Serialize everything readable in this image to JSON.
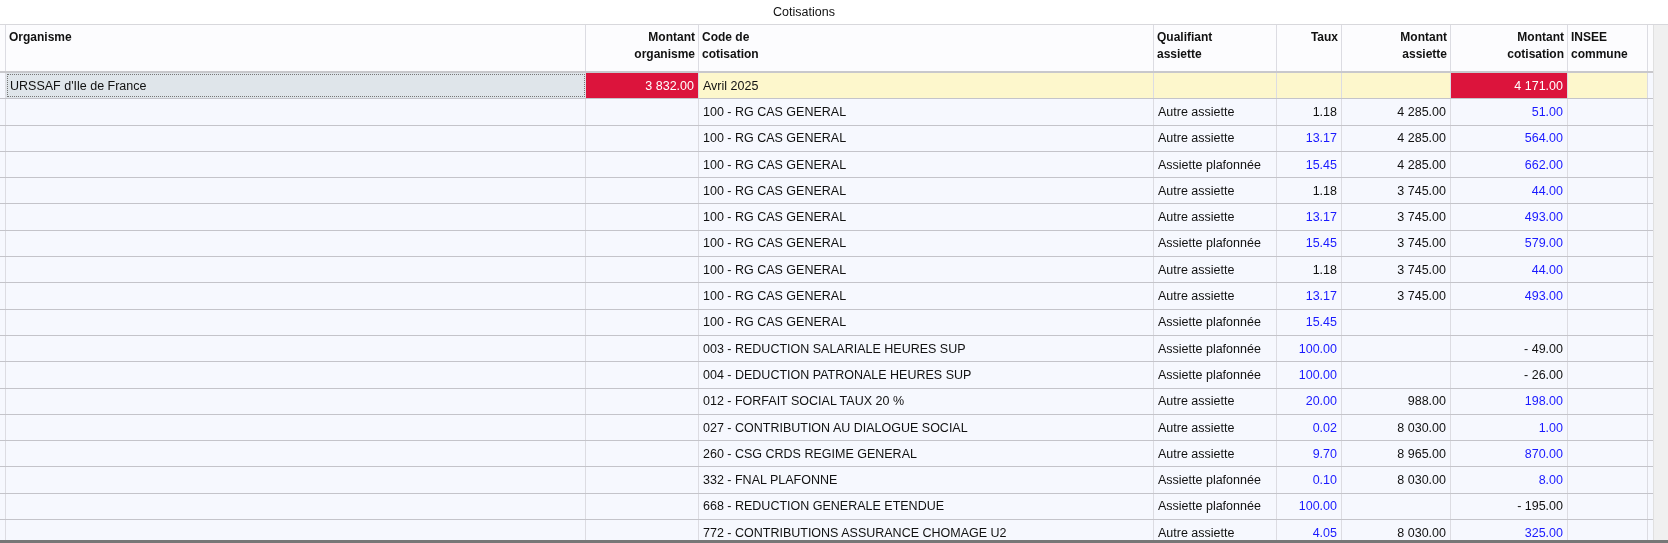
{
  "title": "Cotisations",
  "columns": [
    {
      "lines": [
        "Organisme"
      ]
    },
    {
      "lines": [
        "Montant",
        "organisme"
      ]
    },
    {
      "lines": [
        "Code de",
        "cotisation"
      ]
    },
    {
      "lines": [
        "Qualifiant",
        "assiette"
      ]
    },
    {
      "lines": [
        "Taux"
      ]
    },
    {
      "lines": [
        "Montant",
        "assiette"
      ]
    },
    {
      "lines": [
        "Montant",
        "cotisation"
      ]
    },
    {
      "lines": [
        "INSEE",
        "commune"
      ]
    }
  ],
  "rows": [
    {
      "kind": "group",
      "organisme": "URSSAF d'Ile de France",
      "selected": true,
      "montant_organisme": "3 832.00",
      "code": "Avril 2025",
      "montant_cotisation": "4 171.00"
    },
    {
      "kind": "detail",
      "code": "100 - RG CAS GENERAL",
      "qualifiant": "Autre assiette",
      "taux": "1.18",
      "taux_highlighted": false,
      "montant_assiette": "4 285.00",
      "montant_cotisation": "51.00",
      "cotisation_highlighted": true
    },
    {
      "kind": "detail",
      "code": "100 - RG CAS GENERAL",
      "qualifiant": "Autre assiette",
      "taux": "13.17",
      "taux_highlighted": true,
      "montant_assiette": "4 285.00",
      "montant_cotisation": "564.00",
      "cotisation_highlighted": true
    },
    {
      "kind": "detail",
      "code": "100 - RG CAS GENERAL",
      "qualifiant": "Assiette plafonnée",
      "taux": "15.45",
      "taux_highlighted": true,
      "montant_assiette": "4 285.00",
      "montant_cotisation": "662.00",
      "cotisation_highlighted": true
    },
    {
      "kind": "detail",
      "code": "100 - RG CAS GENERAL",
      "qualifiant": "Autre assiette",
      "taux": "1.18",
      "taux_highlighted": false,
      "montant_assiette": "3 745.00",
      "montant_cotisation": "44.00",
      "cotisation_highlighted": true
    },
    {
      "kind": "detail",
      "code": "100 - RG CAS GENERAL",
      "qualifiant": "Autre assiette",
      "taux": "13.17",
      "taux_highlighted": true,
      "montant_assiette": "3 745.00",
      "montant_cotisation": "493.00",
      "cotisation_highlighted": true
    },
    {
      "kind": "detail",
      "code": "100 - RG CAS GENERAL",
      "qualifiant": "Assiette plafonnée",
      "taux": "15.45",
      "taux_highlighted": true,
      "montant_assiette": "3 745.00",
      "montant_cotisation": "579.00",
      "cotisation_highlighted": true
    },
    {
      "kind": "detail",
      "code": "100 - RG CAS GENERAL",
      "qualifiant": "Autre assiette",
      "taux": "1.18",
      "taux_highlighted": false,
      "montant_assiette": "3 745.00",
      "montant_cotisation": "44.00",
      "cotisation_highlighted": true
    },
    {
      "kind": "detail",
      "code": "100 - RG CAS GENERAL",
      "qualifiant": "Autre assiette",
      "taux": "13.17",
      "taux_highlighted": true,
      "montant_assiette": "3 745.00",
      "montant_cotisation": "493.00",
      "cotisation_highlighted": true
    },
    {
      "kind": "detail",
      "code": "100 - RG CAS GENERAL",
      "qualifiant": "Assiette plafonnée",
      "taux": "15.45",
      "taux_highlighted": true
    },
    {
      "kind": "detail",
      "code": "003 - REDUCTION SALARIALE HEURES SUP",
      "qualifiant": "Assiette plafonnée",
      "taux": "100.00",
      "taux_highlighted": true,
      "montant_cotisation": "- 49.00",
      "cotisation_highlighted": false
    },
    {
      "kind": "detail",
      "code": "004 - DEDUCTION PATRONALE HEURES SUP",
      "qualifiant": "Assiette plafonnée",
      "taux": "100.00",
      "taux_highlighted": true,
      "montant_cotisation": "- 26.00",
      "cotisation_highlighted": false
    },
    {
      "kind": "detail",
      "code": "012 - FORFAIT SOCIAL TAUX 20 %",
      "qualifiant": "Autre assiette",
      "taux": "20.00",
      "taux_highlighted": true,
      "montant_assiette": "988.00",
      "montant_cotisation": "198.00",
      "cotisation_highlighted": true
    },
    {
      "kind": "detail",
      "code": "027 - CONTRIBUTION AU DIALOGUE SOCIAL",
      "qualifiant": "Autre assiette",
      "taux": "0.02",
      "taux_highlighted": true,
      "montant_assiette": "8 030.00",
      "montant_cotisation": "1.00",
      "cotisation_highlighted": true
    },
    {
      "kind": "detail",
      "code": "260 - CSG CRDS REGIME GENERAL",
      "qualifiant": "Autre assiette",
      "taux": "9.70",
      "taux_highlighted": true,
      "montant_assiette": "8 965.00",
      "montant_cotisation": "870.00",
      "cotisation_highlighted": true
    },
    {
      "kind": "detail",
      "code": "332 - FNAL PLAFONNE",
      "qualifiant": "Assiette plafonnée",
      "taux": "0.10",
      "taux_highlighted": true,
      "montant_assiette": "8 030.00",
      "montant_cotisation": "8.00",
      "cotisation_highlighted": true
    },
    {
      "kind": "detail",
      "code": "668 - REDUCTION GENERALE ETENDUE",
      "qualifiant": "Assiette plafonnée",
      "taux": "100.00",
      "taux_highlighted": true,
      "montant_cotisation": "- 195.00",
      "cotisation_highlighted": false
    },
    {
      "kind": "detail",
      "code": "772 - CONTRIBUTIONS ASSURANCE CHOMAGE U2",
      "qualifiant": "Autre assiette",
      "taux": "4.05",
      "taux_highlighted": true,
      "montant_assiette": "8 030.00",
      "montant_cotisation": "325.00",
      "cotisation_highlighted": true
    }
  ]
}
